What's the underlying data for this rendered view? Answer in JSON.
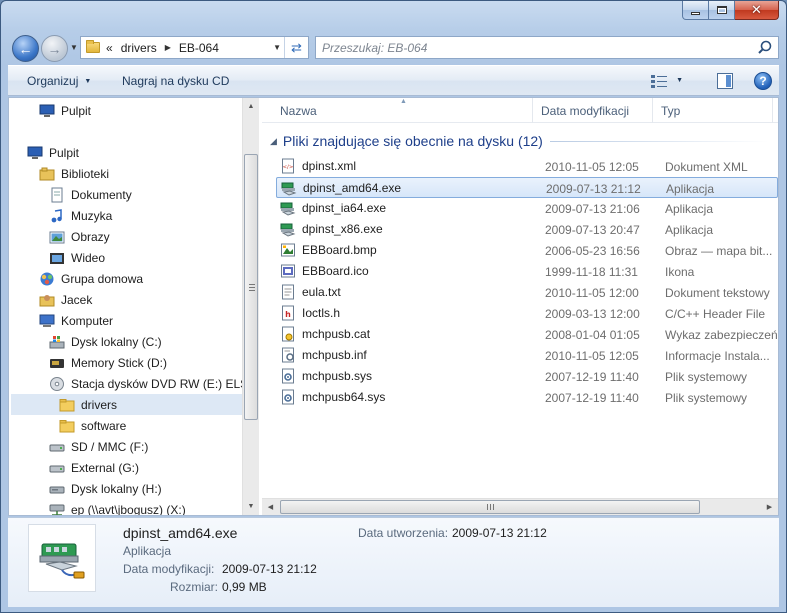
{
  "window": {
    "caption_buttons": {
      "minimize": "minimize",
      "maximize": "maximize",
      "close": "✕"
    }
  },
  "address_bar": {
    "overflow": "«",
    "crumbs": [
      "drivers",
      "EB-064"
    ],
    "search_placeholder": "Przeszukaj: EB-064"
  },
  "toolbar": {
    "organize_label": "Organizuj",
    "burn_label": "Nagraj na dysku CD",
    "help_label": "?"
  },
  "nav_pane": {
    "items": [
      {
        "label": "Pulpit",
        "icon": "desktop-icon",
        "indent": 0
      },
      {
        "label": "Pulpit",
        "icon": "desktop-icon",
        "indent": 0
      },
      {
        "label": "Biblioteki",
        "icon": "libraries-icon",
        "indent": 1
      },
      {
        "label": "Dokumenty",
        "icon": "documents-icon",
        "indent": 2
      },
      {
        "label": "Muzyka",
        "icon": "music-icon",
        "indent": 2
      },
      {
        "label": "Obrazy",
        "icon": "pictures-icon",
        "indent": 2
      },
      {
        "label": "Wideo",
        "icon": "video-icon",
        "indent": 2
      },
      {
        "label": "Grupa domowa",
        "icon": "homegroup-icon",
        "indent": 1
      },
      {
        "label": "Jacek",
        "icon": "user-folder-icon",
        "indent": 1
      },
      {
        "label": "Komputer",
        "icon": "computer-icon",
        "indent": 1
      },
      {
        "label": "Dysk lokalny (C:)",
        "icon": "windows-drive-icon",
        "indent": 2
      },
      {
        "label": "Memory Stick (D:)",
        "icon": "memory-stick-icon",
        "indent": 2
      },
      {
        "label": "Stacja dysków DVD RW (E:) ELSAI",
        "icon": "dvd-drive-icon",
        "indent": 2
      },
      {
        "label": "drivers",
        "icon": "folder-icon",
        "indent": 3,
        "selected": true
      },
      {
        "label": "software",
        "icon": "folder-icon",
        "indent": 3
      },
      {
        "label": "SD / MMC (F:)",
        "icon": "removable-drive-icon",
        "indent": 2
      },
      {
        "label": "External (G:)",
        "icon": "removable-drive-icon",
        "indent": 2
      },
      {
        "label": "Dysk lokalny (H:)",
        "icon": "drive-icon",
        "indent": 2
      },
      {
        "label": "ep (\\\\avt\\jbogusz) (X:)",
        "icon": "network-drive-icon",
        "indent": 2
      }
    ]
  },
  "columns": {
    "name": "Nazwa",
    "date": "Data modyfikacji",
    "type": "Typ"
  },
  "group_header": "Pliki znajdujące się obecnie na dysku (12)",
  "files": [
    {
      "name": "dpinst.xml",
      "date": "2010-11-05 12:05",
      "type": "Dokument XML",
      "icon": "xml-file-icon"
    },
    {
      "name": "dpinst_amd64.exe",
      "date": "2009-07-13 21:12",
      "type": "Aplikacja",
      "icon": "installer-exe-icon",
      "selected": true
    },
    {
      "name": "dpinst_ia64.exe",
      "date": "2009-07-13 21:06",
      "type": "Aplikacja",
      "icon": "installer-exe-icon"
    },
    {
      "name": "dpinst_x86.exe",
      "date": "2009-07-13 20:47",
      "type": "Aplikacja",
      "icon": "installer-exe-icon"
    },
    {
      "name": "EBBoard.bmp",
      "date": "2006-05-23 16:56",
      "type": "Obraz — mapa bit...",
      "icon": "bitmap-file-icon"
    },
    {
      "name": "EBBoard.ico",
      "date": "1999-11-18 11:31",
      "type": "Ikona",
      "icon": "ico-file-icon"
    },
    {
      "name": "eula.txt",
      "date": "2010-11-05 12:00",
      "type": "Dokument tekstowy",
      "icon": "text-file-icon"
    },
    {
      "name": "Ioctls.h",
      "date": "2009-03-13 12:00",
      "type": "C/C++ Header File",
      "icon": "header-file-icon"
    },
    {
      "name": "mchpusb.cat",
      "date": "2008-01-04 01:05",
      "type": "Wykaz zabezpieczeń",
      "icon": "catalog-file-icon"
    },
    {
      "name": "mchpusb.inf",
      "date": "2010-11-05 12:05",
      "type": "Informacje Instala...",
      "icon": "inf-file-icon"
    },
    {
      "name": "mchpusb.sys",
      "date": "2007-12-19 11:40",
      "type": "Plik systemowy",
      "icon": "system-file-icon"
    },
    {
      "name": "mchpusb64.sys",
      "date": "2007-12-19 11:40",
      "type": "Plik systemowy",
      "icon": "system-file-icon"
    }
  ],
  "details": {
    "file_name": "dpinst_amd64.exe",
    "file_type": "Aplikacja",
    "modified_label": "Data modyfikacji:",
    "modified_value": "2009-07-13 21:12",
    "size_label": "Rozmiar:",
    "size_value": "0,99 MB",
    "created_label": "Data utworzenia:",
    "created_value": "2009-07-13 21:12"
  },
  "colors": {
    "accent": "#1e3f8a",
    "selection": "#d6e6f9",
    "chrome": "#b6cde8"
  }
}
